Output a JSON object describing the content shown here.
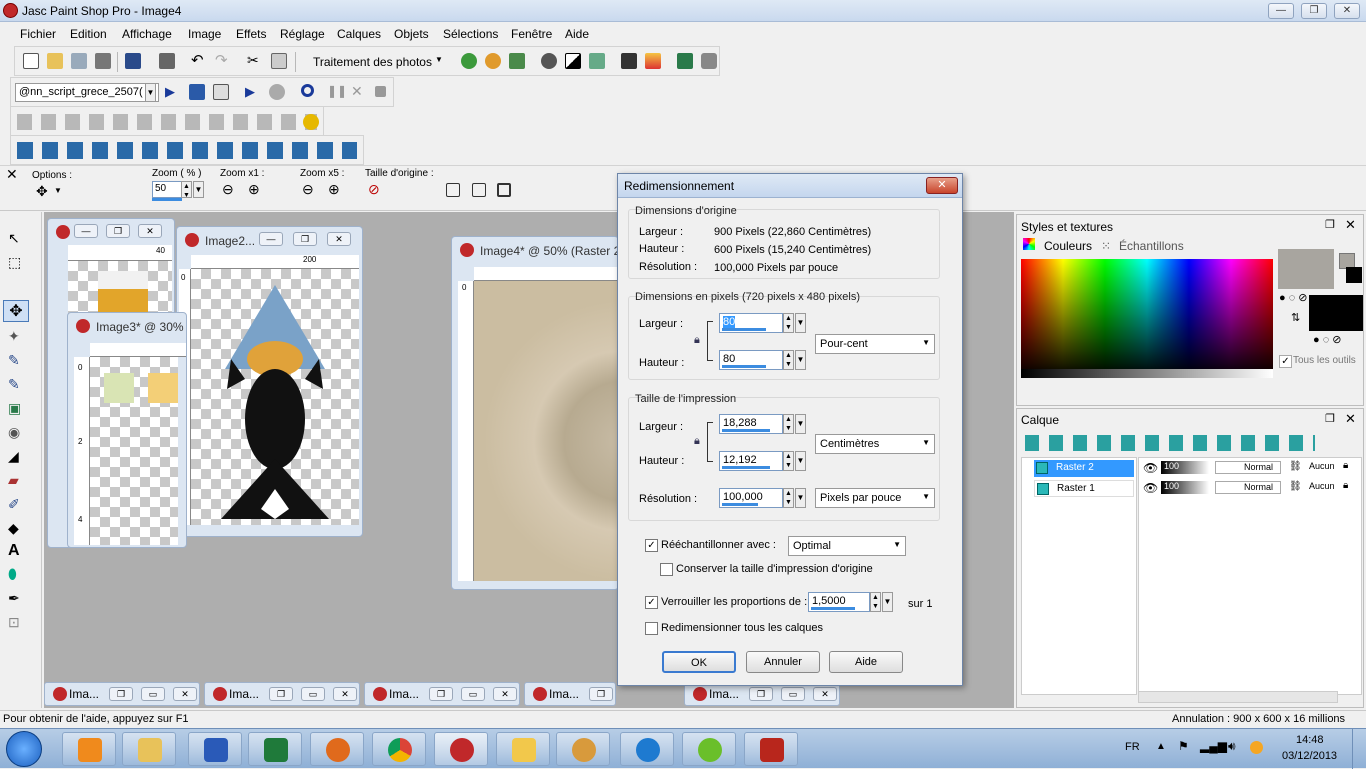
{
  "window": {
    "title": "Jasc Paint Shop Pro - Image4"
  },
  "menu": [
    "Fichier",
    "Edition",
    "Affichage",
    "Image",
    "Effets",
    "Réglage",
    "Calques",
    "Objets",
    "Sélections",
    "Fenêtre",
    "Aide"
  ],
  "toolbar": {
    "photo_menu": "Traitement des photos"
  },
  "script_bar": {
    "script_name": "@nn_script_grece_2507("
  },
  "tool_options": {
    "options_label": "Options :",
    "zoom_pct_label": "Zoom ( % )",
    "zoom_value": "50",
    "zoom_x1_label": "Zoom x1 :",
    "zoom_x5_label": "Zoom x5 :",
    "original_size_label": "Taille d'origine :"
  },
  "child_windows": {
    "image2": "Image2...",
    "image3": "Image3* @  30%",
    "image4": "Image4* @  50% (Raster 2)",
    "ruler_200": "200",
    "ruler_40": "40",
    "ruler_v0": "0",
    "ruler_v2": "2",
    "ruler_v4": "4"
  },
  "minimized": [
    "Ima...",
    "Ima...",
    "Ima...",
    "Ima...",
    "Ima..."
  ],
  "dialog": {
    "title": "Redimensionnement",
    "orig_group": "Dimensions d'origine",
    "orig_width_label": "Largeur :",
    "orig_width": "900 Pixels (22,860 Centimètres)",
    "orig_height_label": "Hauteur :",
    "orig_height": "600 Pixels (15,240 Centimètres)",
    "orig_res_label": "Résolution :",
    "orig_res": "100,000 Pixels par pouce",
    "px_group": "Dimensions en pixels (720 pixels x 480 pixels)",
    "px_width_label": "Largeur :",
    "px_width": "80",
    "px_height_label": "Hauteur :",
    "px_height": "80",
    "px_unit": "Pour-cent",
    "print_group": "Taille de l'impression",
    "pr_width_label": "Largeur :",
    "pr_width": "18,288",
    "pr_height_label": "Hauteur :",
    "pr_height": "12,192",
    "pr_unit": "Centimètres",
    "pr_res_label": "Résolution :",
    "pr_res": "100,000",
    "pr_res_unit": "Pixels par pouce",
    "resample_label": "Rééchantillonner avec :",
    "resample_method": "Optimal",
    "keep_print_label": "Conserver la taille d'impression d'origine",
    "lock_ratio_label": "Verrouiller les proportions de :",
    "ratio_value": "1,5000",
    "ratio_suffix": "sur 1",
    "all_layers_label": "Redimensionner tous les calques",
    "ok": "OK",
    "cancel": "Annuler",
    "help": "Aide"
  },
  "styles_panel": {
    "title": "Styles et textures",
    "tab_colors": "Couleurs",
    "tab_samples": "Échantillons",
    "all_tools": "Tous les outils"
  },
  "layers_panel": {
    "title": "Calque",
    "layers": [
      {
        "name": "Raster 2",
        "opacity": "100",
        "blend": "Normal",
        "mask": "Aucun"
      },
      {
        "name": "Raster 1",
        "opacity": "100",
        "blend": "Normal",
        "mask": "Aucun"
      }
    ]
  },
  "status": {
    "left": "Pour obtenir de l'aide, appuyez sur F1",
    "right": "Annulation :  900 x 600 x 16 millions"
  },
  "taskbar": {
    "lang": "FR",
    "time": "14:48",
    "date": "03/12/2013"
  },
  "colors": {
    "accent": "#3c8ce0",
    "psp_red": "#c0282a"
  }
}
